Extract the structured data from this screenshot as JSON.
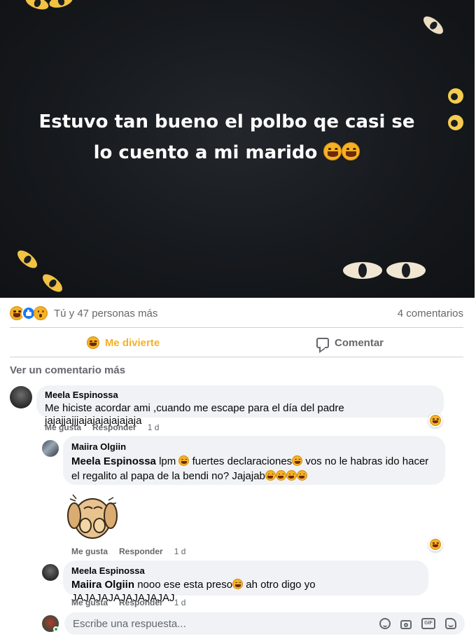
{
  "post": {
    "text": "Estuvo tan bueno el polbo qe casi se lo cuento a mi marido"
  },
  "reactions": {
    "icons": [
      "haha-reaction-icon",
      "like-reaction-icon",
      "wow-reaction-icon"
    ],
    "summary": "Tú y 47 personas más",
    "comment_count": "4 comentarios"
  },
  "actions": {
    "react_label": "Me divierte",
    "comment_label": "Comentar"
  },
  "more_comments": "Ver un comentario más",
  "comments": [
    {
      "author": "Meela Espinossa",
      "text": "Me hiciste acordar ami ,cuando me escape para el día del padre jajajjajjjajajajajajajaja",
      "like": "Me gusta",
      "reply": "Responder",
      "time": "1 d"
    },
    {
      "author": "Maiira Olgiin",
      "mention": "Meela Espinossa",
      "text_1": "lpm",
      "text_2": "fuertes declaraciones",
      "text_3": "vos no le habras ido hacer el regalito al papa de la bendi no? Jajajab",
      "like": "Me gusta",
      "reply": "Responder",
      "time": "1 d"
    },
    {
      "author": "Meela Espinossa",
      "mention": "Maiira Olgiin",
      "text_1": "nooo ese esta preso",
      "text_2": "ah otro digo yo JAJAJAJAJAJAJAJAJ",
      "like": "Me gusta",
      "reply": "Responder",
      "time": "1 d"
    }
  ],
  "reply_box": {
    "placeholder": "Escribe una respuesta...",
    "tools": [
      "emoji-icon",
      "camera-icon",
      "gif-icon",
      "sticker-icon"
    ],
    "gif_label": "GIF"
  },
  "colors": {
    "haha": "#f7b125",
    "like": "#1877f2",
    "bubble": "#f0f2f5",
    "muted": "#65676b"
  }
}
